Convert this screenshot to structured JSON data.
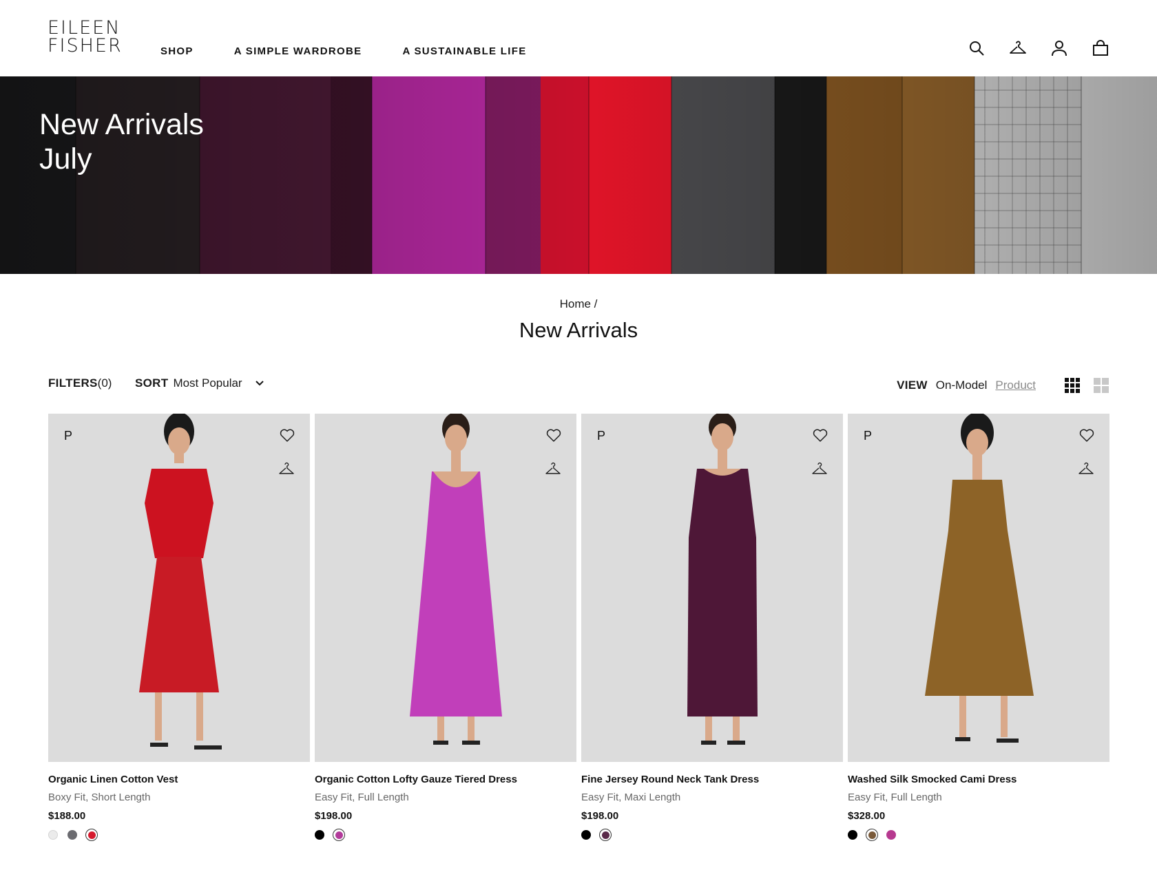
{
  "brand": {
    "line1": "EILEEN",
    "line2": "FISHER"
  },
  "nav": [
    "SHOP",
    "A SIMPLE WARDROBE",
    "A SUSTAINABLE LIFE"
  ],
  "header_icons": [
    "search-icon",
    "hanger-icon",
    "account-icon",
    "bag-icon"
  ],
  "hero": {
    "line1": "New Arrivals",
    "line2": "July"
  },
  "breadcrumb": "Home /",
  "page_title": "New Arrivals",
  "toolbar": {
    "filters_label": "FILTERS",
    "filters_count": "(0)",
    "sort_label": "SORT",
    "sort_value": "Most Popular",
    "view_label": "VIEW",
    "view_on_model": "On-Model",
    "view_product": "Product"
  },
  "products": [
    {
      "badge": "P",
      "name": "Organic Linen Cotton Vest",
      "fit": "Boxy Fit, Short Length",
      "price": "$188.00",
      "swatches": [
        {
          "color": "#ebebeb",
          "selected": false
        },
        {
          "color": "#6b6b70",
          "selected": false
        },
        {
          "color": "#d51a2e",
          "selected": true
        }
      ],
      "garment": "#cc1220"
    },
    {
      "badge": "",
      "name": "Organic Cotton Lofty Gauze Tiered Dress",
      "fit": "Easy Fit, Full Length",
      "price": "$198.00",
      "swatches": [
        {
          "color": "#000000",
          "selected": false
        },
        {
          "color": "#b23a9a",
          "selected": true
        }
      ],
      "garment": "#c13fba"
    },
    {
      "badge": "P",
      "name": "Fine Jersey Round Neck Tank Dress",
      "fit": "Easy Fit, Maxi Length",
      "price": "$198.00",
      "swatches": [
        {
          "color": "#000000",
          "selected": false
        },
        {
          "color": "#5a2a4a",
          "selected": true
        }
      ],
      "garment": "#4e1737"
    },
    {
      "badge": "P",
      "name": "Washed Silk Smocked Cami Dress",
      "fit": "Easy Fit, Full Length",
      "price": "$328.00",
      "swatches": [
        {
          "color": "#000000",
          "selected": false
        },
        {
          "color": "#7a5a3a",
          "selected": true
        },
        {
          "color": "#b6398f",
          "selected": false
        }
      ],
      "garment": "#8d6327"
    }
  ]
}
